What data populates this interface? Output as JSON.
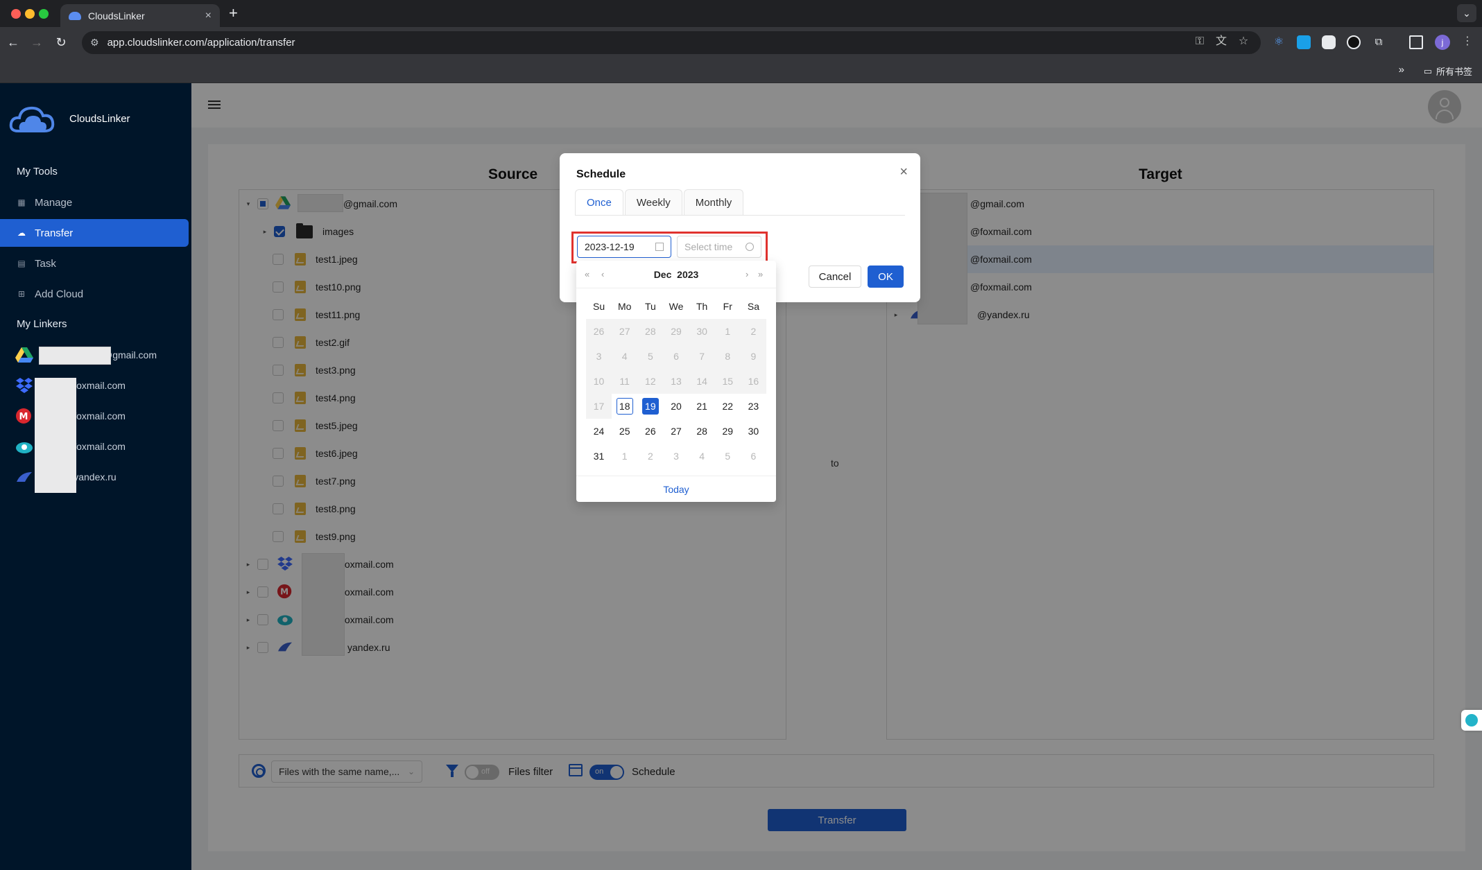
{
  "browser": {
    "tab_title": "CloudsLinker",
    "tab_close": "×",
    "new_tab": "+",
    "url": "app.cloudslinker.com/application/transfer",
    "bookmarks_label": "所有书签",
    "profile_initial": "j"
  },
  "sidebar": {
    "brand": "CloudsLinker",
    "my_tools_label": "My Tools",
    "nav": [
      {
        "label": "Manage",
        "icon": "grid-icon"
      },
      {
        "label": "Transfer",
        "icon": "cloud-transfer-icon",
        "active": true
      },
      {
        "label": "Task",
        "icon": "calendar-icon"
      },
      {
        "label": "Add Cloud",
        "icon": "add-cloud-icon"
      }
    ],
    "my_linkers_label": "My Linkers",
    "linkers": [
      {
        "label": "@gmail.com",
        "service": "google-drive"
      },
      {
        "label": "@foxmail.com",
        "service": "dropbox"
      },
      {
        "label": "@foxmail.com",
        "service": "mega"
      },
      {
        "label": "@foxmail.com",
        "service": "pcloud"
      },
      {
        "label": "@yandex.ru",
        "service": "yandex"
      }
    ]
  },
  "source": {
    "title": "Source",
    "rows": [
      {
        "label": "@gmail.com",
        "type": "account",
        "service": "google-drive",
        "caret": "▾",
        "check": "partial"
      },
      {
        "label": "images",
        "type": "folder",
        "caret": "▸",
        "check": "checked"
      },
      {
        "label": "test1.jpeg",
        "type": "file"
      },
      {
        "label": "test10.png",
        "type": "file"
      },
      {
        "label": "test11.png",
        "type": "file"
      },
      {
        "label": "test2.gif",
        "type": "file"
      },
      {
        "label": "test3.png",
        "type": "file"
      },
      {
        "label": "test4.png",
        "type": "file"
      },
      {
        "label": "test5.jpeg",
        "type": "file"
      },
      {
        "label": "test6.jpeg",
        "type": "file"
      },
      {
        "label": "test7.png",
        "type": "file"
      },
      {
        "label": "test8.png",
        "type": "file"
      },
      {
        "label": "test9.png",
        "type": "file"
      },
      {
        "label": "foxmail.com",
        "type": "account",
        "service": "dropbox",
        "caret": "▸"
      },
      {
        "label": "foxmail.com",
        "type": "account",
        "service": "mega",
        "caret": "▸"
      },
      {
        "label": "foxmail.com",
        "type": "account",
        "service": "pcloud",
        "caret": "▸"
      },
      {
        "label": "yandex.ru",
        "type": "account",
        "service": "yandex",
        "caret": "▸"
      }
    ]
  },
  "target": {
    "title": "Target",
    "rows": [
      {
        "label": "@gmail.com"
      },
      {
        "label": "@foxmail.com"
      },
      {
        "label": "@foxmail.com",
        "highlight": true
      },
      {
        "label": "@foxmail.com"
      },
      {
        "label": "@yandex.ru",
        "caret": "▸"
      }
    ]
  },
  "to_label": "to",
  "options": {
    "conflict_select": "Files with the same name,...",
    "filter_switch": "off",
    "filter_label": "Files filter",
    "schedule_switch": "on",
    "schedule_label": "Schedule"
  },
  "transfer_button": "Transfer",
  "modal": {
    "title": "Schedule",
    "close": "×",
    "tabs": [
      "Once",
      "Weekly",
      "Monthly"
    ],
    "active_tab": "Once",
    "date_value": "2023-12-19",
    "time_placeholder": "Select time",
    "cancel": "Cancel",
    "ok": "OK"
  },
  "datepicker": {
    "month": "Dec",
    "year": "2023",
    "nav_prev_year": "«",
    "nav_prev_month": "‹",
    "nav_next_month": "›",
    "nav_next_year": "»",
    "weekdays": [
      "Su",
      "Mo",
      "Tu",
      "We",
      "Th",
      "Fr",
      "Sa"
    ],
    "weeks": [
      [
        {
          "d": "26",
          "s": "dis"
        },
        {
          "d": "27",
          "s": "dis"
        },
        {
          "d": "28",
          "s": "dis"
        },
        {
          "d": "29",
          "s": "dis"
        },
        {
          "d": "30",
          "s": "dis"
        },
        {
          "d": "1",
          "s": "dis"
        },
        {
          "d": "2",
          "s": "dis"
        }
      ],
      [
        {
          "d": "3",
          "s": "dis"
        },
        {
          "d": "4",
          "s": "dis"
        },
        {
          "d": "5",
          "s": "dis"
        },
        {
          "d": "6",
          "s": "dis"
        },
        {
          "d": "7",
          "s": "dis"
        },
        {
          "d": "8",
          "s": "dis"
        },
        {
          "d": "9",
          "s": "dis"
        }
      ],
      [
        {
          "d": "10",
          "s": "dis"
        },
        {
          "d": "11",
          "s": "dis"
        },
        {
          "d": "12",
          "s": "dis"
        },
        {
          "d": "13",
          "s": "dis"
        },
        {
          "d": "14",
          "s": "dis"
        },
        {
          "d": "15",
          "s": "dis"
        },
        {
          "d": "16",
          "s": "dis"
        }
      ],
      [
        {
          "d": "17",
          "s": "dis"
        },
        {
          "d": "18",
          "s": "today"
        },
        {
          "d": "19",
          "s": "sel"
        },
        {
          "d": "20",
          "s": ""
        },
        {
          "d": "21",
          "s": ""
        },
        {
          "d": "22",
          "s": ""
        },
        {
          "d": "23",
          "s": ""
        }
      ],
      [
        {
          "d": "24",
          "s": ""
        },
        {
          "d": "25",
          "s": ""
        },
        {
          "d": "26",
          "s": ""
        },
        {
          "d": "27",
          "s": ""
        },
        {
          "d": "28",
          "s": ""
        },
        {
          "d": "29",
          "s": ""
        },
        {
          "d": "30",
          "s": ""
        }
      ],
      [
        {
          "d": "31",
          "s": ""
        },
        {
          "d": "1",
          "s": "out"
        },
        {
          "d": "2",
          "s": "out"
        },
        {
          "d": "3",
          "s": "out"
        },
        {
          "d": "4",
          "s": "out"
        },
        {
          "d": "5",
          "s": "out"
        },
        {
          "d": "6",
          "s": "out"
        }
      ]
    ],
    "today_label": "Today"
  },
  "colors": {
    "accent": "#1f5fd1",
    "sidebar_bg": "#001529",
    "highlight_box": "#e0322e"
  }
}
